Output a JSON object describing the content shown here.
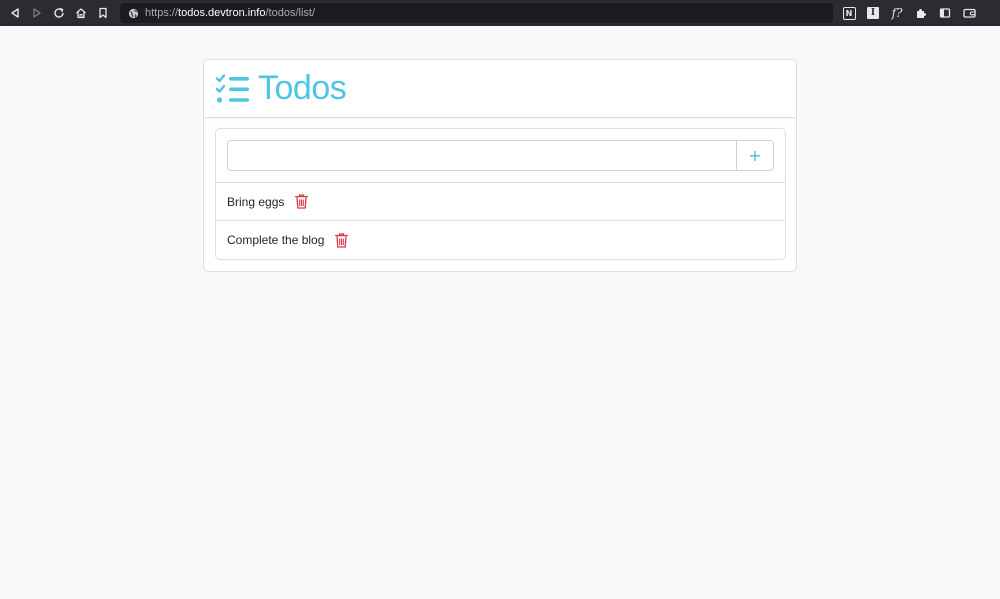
{
  "browser": {
    "url_scheme": "https://",
    "url_host": "todos.devtron.info",
    "url_path": "/todos/list/",
    "extensions": {
      "notion_label": "N",
      "info_label": "I",
      "fx_label": "f?"
    }
  },
  "app": {
    "title": "Todos",
    "accent_color": "#4ec6e2",
    "delete_color": "#dc3545"
  },
  "new_todo": {
    "value": "",
    "placeholder": "",
    "add_label": "+"
  },
  "todos": [
    {
      "text": "Bring eggs"
    },
    {
      "text": "Complete the blog"
    }
  ]
}
